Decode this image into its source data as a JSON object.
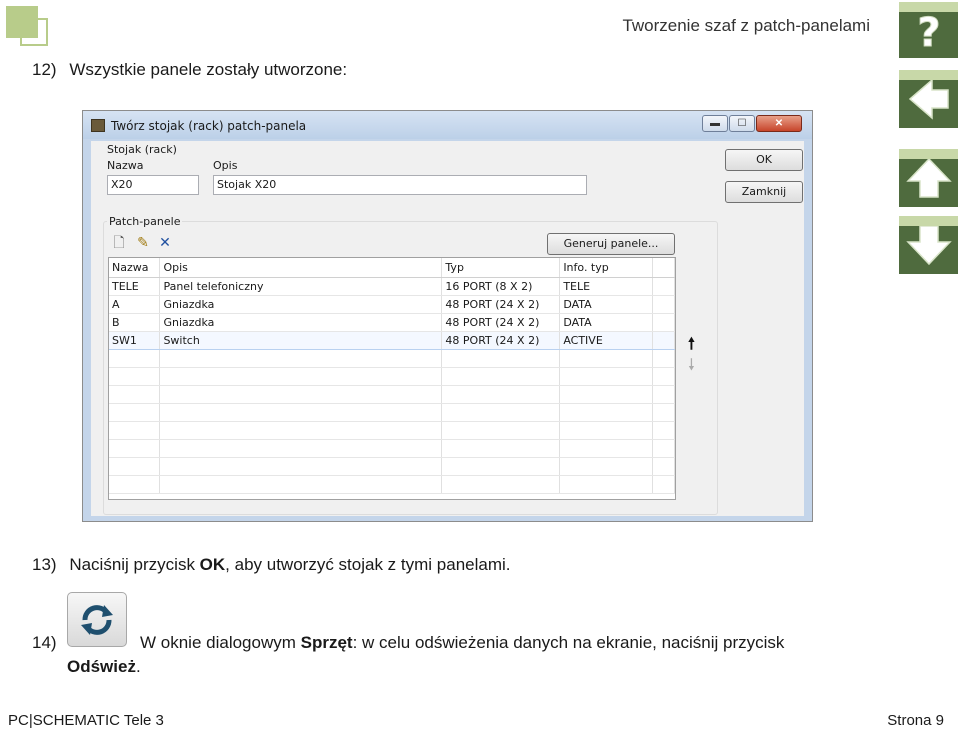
{
  "header": {
    "doc_title": "Tworzenie szaf z patch-panelami"
  },
  "nav": {
    "help_icon": "question-mark-icon",
    "back_icon": "arrow-left-icon",
    "up_icon": "arrow-up-icon",
    "down_icon": "arrow-down-icon",
    "colors": {
      "dark": "#4f6b3e",
      "light": "#c8d8a8",
      "logo": "#b8cc8a"
    }
  },
  "step12": {
    "num": "12)",
    "text": "Wszystkie panele zostały utworzone:"
  },
  "dialog": {
    "title": "Twórz stojak (rack) patch-panela",
    "rack_group": "Stojak (rack)",
    "nazwa_label": "Nazwa",
    "nazwa_value": "X20",
    "opis_label": "Opis",
    "opis_value": "Stojak X20",
    "ok_label": "OK",
    "close_label": "Zamknij",
    "panels_group": "Patch-panele",
    "generate_label": "Generuj panele...",
    "columns": [
      "Nazwa",
      "Opis",
      "Typ",
      "Info. typ"
    ],
    "rows": [
      {
        "nazwa": "TELE",
        "opis": "Panel telefoniczny",
        "typ": "16 PORT (8 X 2)",
        "info": "TELE"
      },
      {
        "nazwa": "A",
        "opis": "Gniazdka",
        "typ": "48 PORT (24 X 2)",
        "info": "DATA"
      },
      {
        "nazwa": "B",
        "opis": "Gniazdka",
        "typ": "48 PORT (24 X 2)",
        "info": "DATA"
      },
      {
        "nazwa": "SW1",
        "opis": "Switch",
        "typ": "48 PORT (24 X 2)",
        "info": "ACTIVE"
      }
    ]
  },
  "step13": {
    "num": "13)",
    "pre": "Naciśnij przycisk ",
    "bold": "OK",
    "post": ", aby utworzyć stojak z tymi panelami."
  },
  "step14": {
    "num": "14)",
    "pre": "W oknie dialogowym ",
    "bold1": "Sprzęt",
    "mid": ": w celu odświeżenia danych na ekranie, naciśnij przycisk",
    "bold2": "Odśwież",
    "post": "."
  },
  "footer": {
    "left": "PC|SCHEMATIC Tele 3",
    "right": "Strona 9"
  }
}
